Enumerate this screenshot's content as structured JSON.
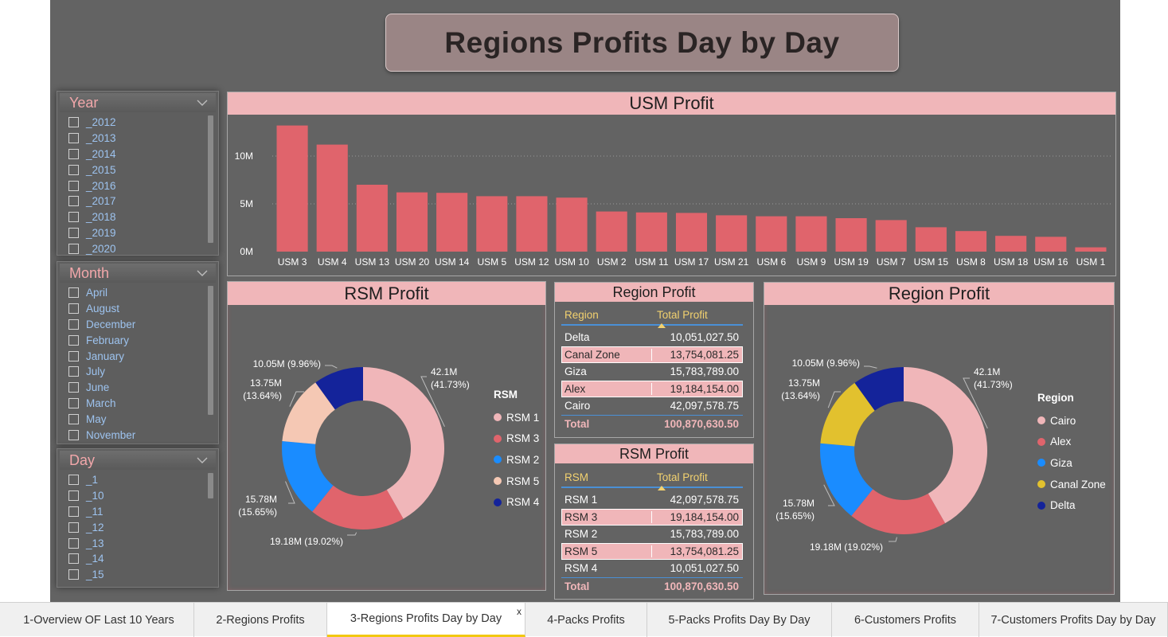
{
  "report": {
    "title": "Regions Profits Day by Day"
  },
  "slicers": {
    "year": {
      "title": "Year",
      "items": [
        "_2012",
        "_2013",
        "_2014",
        "_2015",
        "_2016",
        "_2017",
        "_2018",
        "_2019",
        "_2020"
      ]
    },
    "month": {
      "title": "Month",
      "items": [
        "April",
        "August",
        "December",
        "February",
        "January",
        "July",
        "June",
        "March",
        "May",
        "November"
      ]
    },
    "day": {
      "title": "Day",
      "items": [
        "_1",
        "_10",
        "_11",
        "_12",
        "_13",
        "_14",
        "_15"
      ]
    }
  },
  "usm_profit": {
    "title": "USM Profit"
  },
  "rsm_profit_donut": {
    "title": "RSM Profit",
    "legend_title": "RSM"
  },
  "region_profit_donut": {
    "title": "Region Profit",
    "legend_title": "Region"
  },
  "region_table": {
    "title": "Region Profit",
    "col_region": "Region",
    "col_profit": "Total Profit",
    "rows": [
      {
        "name": "Delta",
        "value": "10,051,027.50",
        "highlight": false
      },
      {
        "name": "Canal Zone",
        "value": "13,754,081.25",
        "highlight": true
      },
      {
        "name": "Giza",
        "value": "15,783,789.00",
        "highlight": false
      },
      {
        "name": "Alex",
        "value": "19,184,154.00",
        "highlight": true
      },
      {
        "name": "Cairo",
        "value": "42,097,578.75",
        "highlight": false
      }
    ],
    "total_label": "Total",
    "total_value": "100,870,630.50"
  },
  "rsm_table": {
    "title": "RSM Profit",
    "col_rsm": "RSM",
    "col_profit": "Total Profit",
    "rows": [
      {
        "name": "RSM 1",
        "value": "42,097,578.75",
        "highlight": false
      },
      {
        "name": "RSM 3",
        "value": "19,184,154.00",
        "highlight": true
      },
      {
        "name": "RSM 2",
        "value": "15,783,789.00",
        "highlight": false
      },
      {
        "name": "RSM 5",
        "value": "13,754,081.25",
        "highlight": true
      },
      {
        "name": "RSM 4",
        "value": "10,051,027.50",
        "highlight": false
      }
    ],
    "total_label": "Total",
    "total_value": "100,870,630.50"
  },
  "tabs": [
    {
      "label": "1-Overview OF Last 10 Years",
      "active": false
    },
    {
      "label": "2-Regions Profits",
      "active": false
    },
    {
      "label": "3-Regions Profits Day by Day",
      "active": true
    },
    {
      "label": "4-Packs Profits",
      "active": false
    },
    {
      "label": "5-Packs Profits Day By Day",
      "active": false
    },
    {
      "label": "6-Customers Profits",
      "active": false
    },
    {
      "label": "7-Customers Profits Day by Day",
      "active": false
    }
  ],
  "tab_close_glyph": "x",
  "colors": {
    "canvas": "#636363",
    "bar": "#e0646c",
    "header_pink": "#f0b6b9",
    "slicer_text": "#9dc3ef",
    "table_header": "#f2d16f"
  },
  "chart_data": [
    {
      "type": "bar",
      "title": "USM Profit",
      "categories": [
        "USM 3",
        "USM 4",
        "USM 13",
        "USM 20",
        "USM 14",
        "USM 5",
        "USM 12",
        "USM 10",
        "USM 2",
        "USM 11",
        "USM 17",
        "USM 21",
        "USM 6",
        "USM 9",
        "USM 19",
        "USM 7",
        "USM 15",
        "USM 8",
        "USM 18",
        "USM 16",
        "USM 1"
      ],
      "values": [
        13.2,
        11.2,
        7.0,
        6.2,
        6.15,
        5.8,
        5.8,
        5.65,
        4.2,
        4.1,
        4.05,
        3.8,
        3.7,
        3.7,
        3.5,
        3.3,
        2.55,
        2.15,
        1.65,
        1.55,
        0.45
      ],
      "unit": "M",
      "yticks": [
        "0M",
        "5M",
        "10M"
      ],
      "ylim": [
        0,
        14
      ],
      "grid": true,
      "color": "#e0646c"
    },
    {
      "type": "pie",
      "donut": true,
      "title": "RSM Profit",
      "legend_title": "RSM",
      "legend_position": "right",
      "slices": [
        {
          "name": "RSM 1",
          "value": 42.1,
          "percent": 41.73,
          "label_top": "42.1M",
          "label_bottom": "(41.73%)",
          "color": "#f0b6b9"
        },
        {
          "name": "RSM 3",
          "value": 19.18,
          "percent": 19.02,
          "label_top": "19.18M (19.02%)",
          "label_bottom": "",
          "color": "#e0646c"
        },
        {
          "name": "RSM 2",
          "value": 15.78,
          "percent": 15.65,
          "label_top": "15.78M",
          "label_bottom": "(15.65%)",
          "color": "#1a8cff"
        },
        {
          "name": "RSM 5",
          "value": 13.75,
          "percent": 13.64,
          "label_top": "13.75M",
          "label_bottom": "(13.64%)",
          "color": "#f5c8b4"
        },
        {
          "name": "RSM 4",
          "value": 10.05,
          "percent": 9.96,
          "label_top": "10.05M (9.96%)",
          "label_bottom": "",
          "color": "#14239a"
        }
      ]
    },
    {
      "type": "pie",
      "donut": true,
      "title": "Region Profit",
      "legend_title": "Region",
      "legend_position": "right",
      "slices": [
        {
          "name": "Cairo",
          "value": 42.1,
          "percent": 41.73,
          "label_top": "42.1M",
          "label_bottom": "(41.73%)",
          "color": "#f0b6b9"
        },
        {
          "name": "Alex",
          "value": 19.18,
          "percent": 19.02,
          "label_top": "19.18M (19.02%)",
          "label_bottom": "",
          "color": "#e0646c"
        },
        {
          "name": "Giza",
          "value": 15.78,
          "percent": 15.65,
          "label_top": "15.78M",
          "label_bottom": "(15.65%)",
          "color": "#1a8cff"
        },
        {
          "name": "Canal Zone",
          "value": 13.75,
          "percent": 13.64,
          "label_top": "13.75M",
          "label_bottom": "(13.64%)",
          "color": "#e2c12e"
        },
        {
          "name": "Delta",
          "value": 10.05,
          "percent": 9.96,
          "label_top": "10.05M (9.96%)",
          "label_bottom": "",
          "color": "#14239a"
        }
      ]
    }
  ]
}
